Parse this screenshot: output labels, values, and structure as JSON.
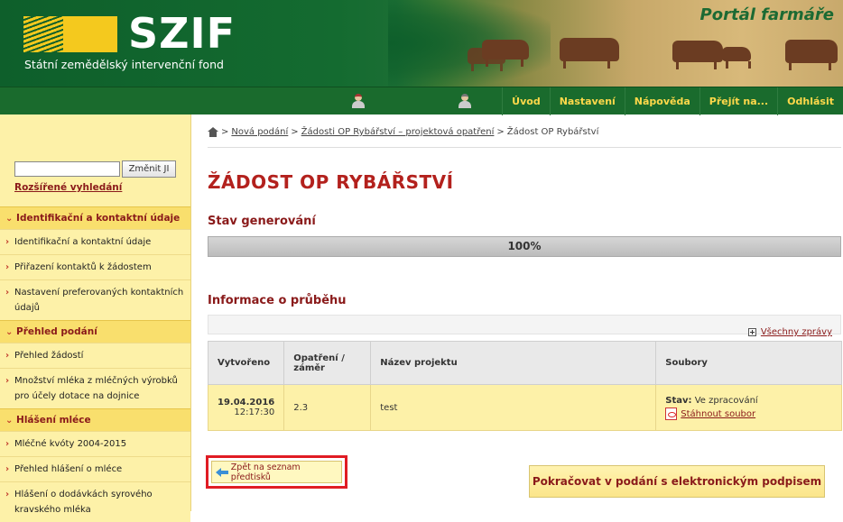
{
  "header": {
    "logo_text": "SZIF",
    "logo_subtitle": "Státní zemědělský intervenční fond",
    "portal_title": "Portál farmáře"
  },
  "nav": {
    "items": [
      "Úvod",
      "Nastavení",
      "Nápověda",
      "Přejít na...",
      "Odhlásit"
    ]
  },
  "sidebar": {
    "search_value": "",
    "search_button": "Změnit JI",
    "advanced_search": "Rozšířené vyhledání",
    "sections": [
      {
        "title": "Identifikační a kontaktní údaje",
        "items": [
          "Identifikační a kontaktní údaje",
          "Přiřazení kontaktů k žádostem",
          "Nastavení preferovaných kontaktních údajů"
        ]
      },
      {
        "title": "Přehled podání",
        "items": [
          "Přehled žádostí",
          "Množství mléka z mléčných výrobků pro účely dotace na dojnice"
        ]
      },
      {
        "title": "Hlášení mléce",
        "items": [
          "Mléčné kvóty 2004-2015",
          "Přehled hlášení o mléce",
          "Hlášení o dodávkách syrového kravského mléka"
        ]
      }
    ]
  },
  "breadcrumb": {
    "items": [
      "Nová podání",
      "Žádosti OP Rybářství – projektová opatření"
    ],
    "current": "Žádost OP Rybářství"
  },
  "page": {
    "title": "ŽÁDOST OP RYBÁŘSTVÍ",
    "generation_title": "Stav generování",
    "progress_label": "100%",
    "progress_fraction": 1.0,
    "info_title": "Informace o průběhu",
    "all_messages": "Všechny zprávy"
  },
  "table": {
    "headers": [
      "Vytvořeno",
      "Opatření / záměr",
      "Název projektu",
      "Soubory"
    ],
    "rows": [
      {
        "date": "19.04.2016",
        "time": "12:17:30",
        "measure": "2.3",
        "project": "test",
        "status_label": "Stav:",
        "status_value": "Ve zpracování",
        "download": "Stáhnout soubor"
      }
    ]
  },
  "actions": {
    "back": "Zpět na seznam předtisků",
    "continue": "Pokračovat v podání s elektronickým podpisem"
  },
  "colors": {
    "brand_green": "#1a6b2d",
    "accent_red": "#b3211d",
    "sidebar_yellow": "#fdf1a8",
    "highlight_red": "#e01c24"
  }
}
